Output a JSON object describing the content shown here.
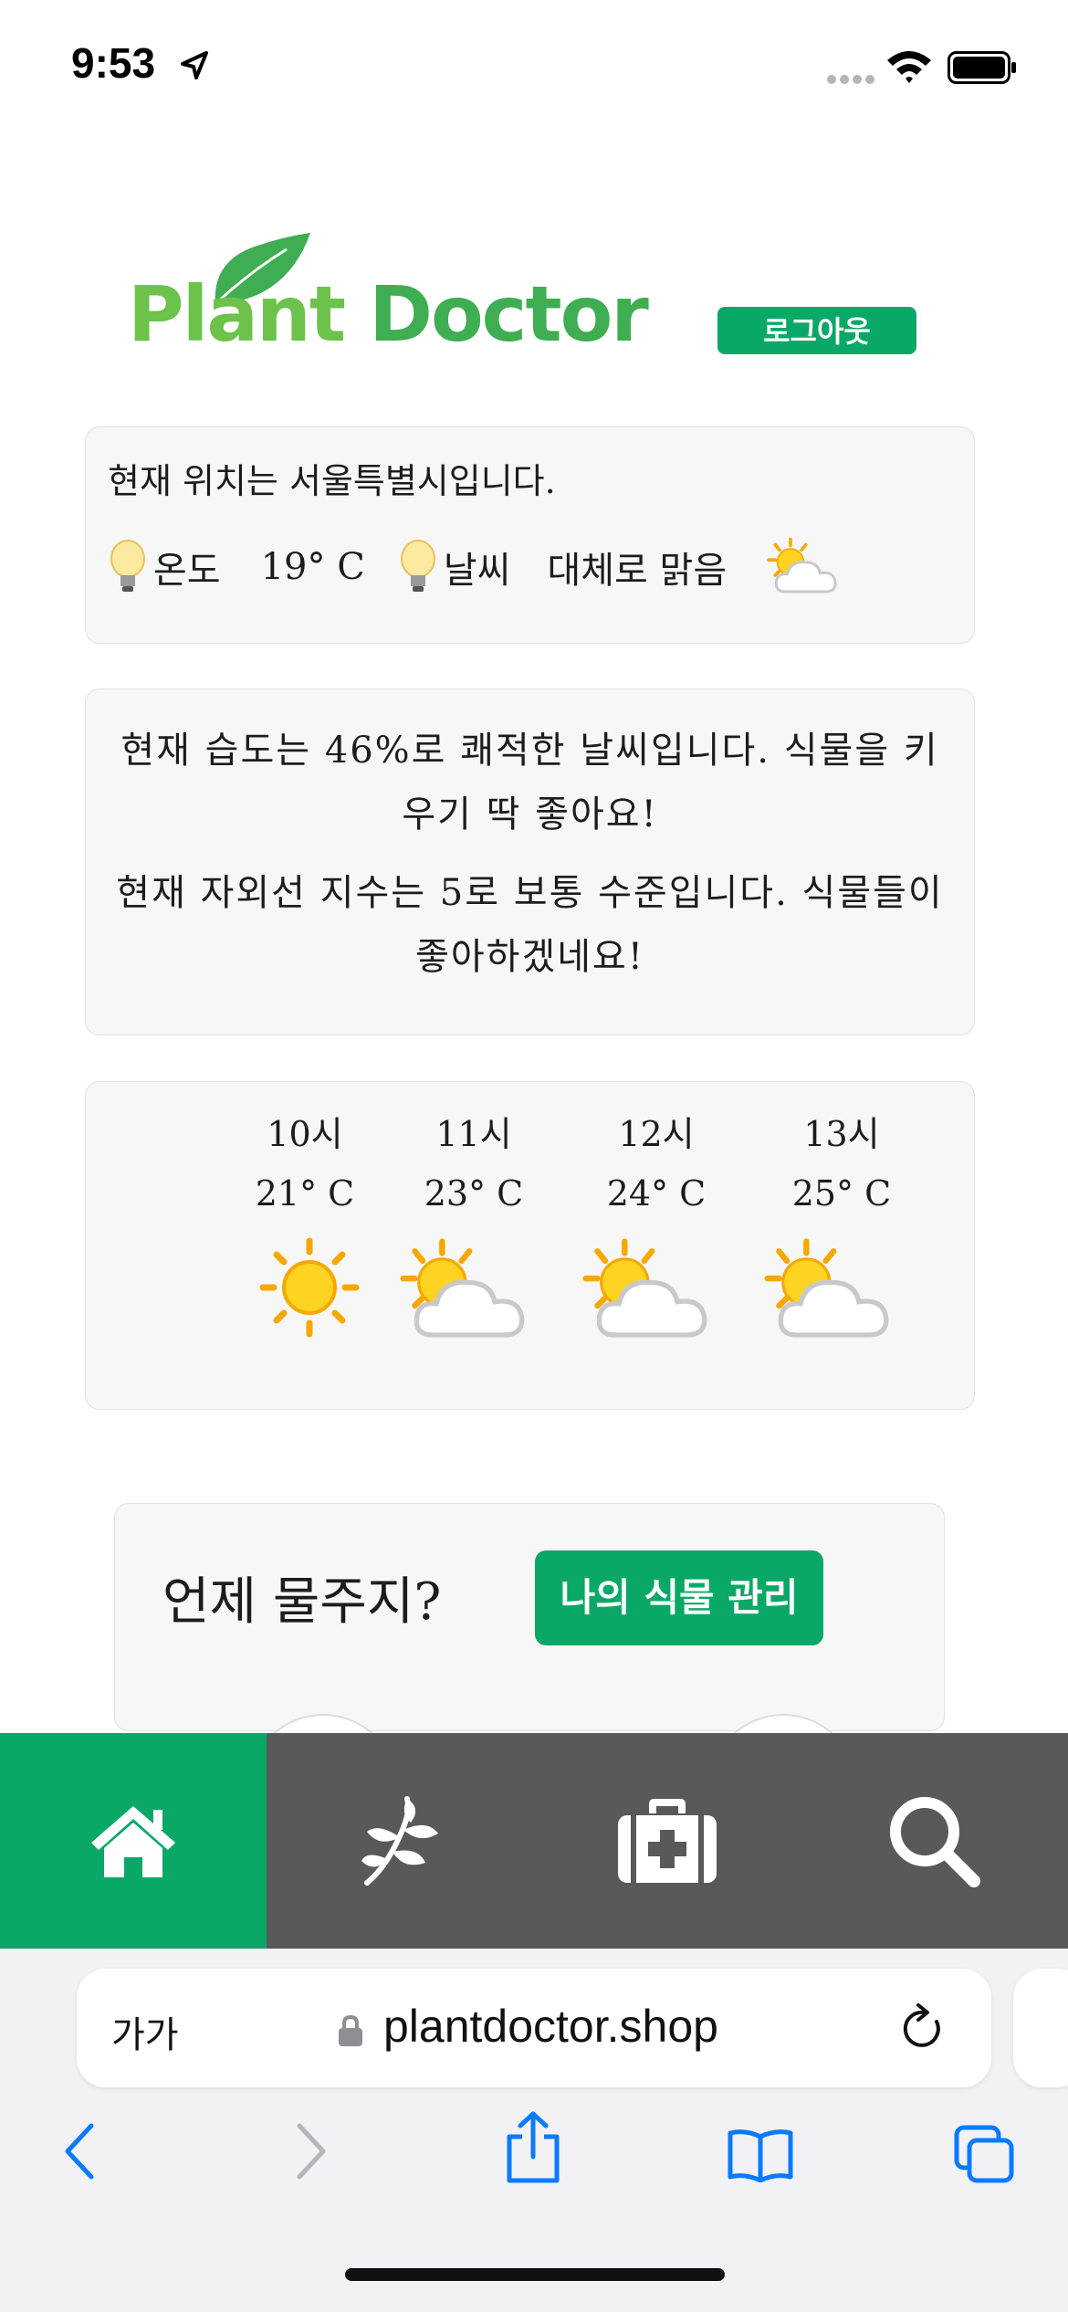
{
  "status_bar": {
    "time": "9:53"
  },
  "header": {
    "logo_word1": "Plant",
    "logo_word2": "Doctor",
    "logout_label": "로그아웃"
  },
  "location_card": {
    "location_text": "현재 위치는 서울특별시입니다.",
    "temp_label": "온도",
    "temp_value": "19° C",
    "weather_label": "날씨",
    "weather_value": "대체로 맑음",
    "weather_icon": "sun-behind-cloud-icon"
  },
  "info_card": {
    "humidity_text": "현재 습도는 46%로 쾌적한 날씨입니다. 식물을 키우기 딱 좋아요!",
    "uv_text": "현재 자외선 지수는 5로 보통 수준입니다. 식물들이 좋아하겠네요!"
  },
  "hourly": [
    {
      "hour": "10시",
      "temp": "21° C",
      "icon": "sun-icon"
    },
    {
      "hour": "11시",
      "temp": "23° C",
      "icon": "sun-behind-cloud-icon"
    },
    {
      "hour": "12시",
      "temp": "24° C",
      "icon": "sun-behind-cloud-icon"
    },
    {
      "hour": "13시",
      "temp": "25° C",
      "icon": "sun-behind-cloud-icon"
    }
  ],
  "watering_card": {
    "title": "언제 물주지?",
    "my_plants_button": "나의 식물 관리"
  },
  "bottom_nav": {
    "items": [
      {
        "icon": "home-icon",
        "active": true
      },
      {
        "icon": "plant-icon",
        "active": false
      },
      {
        "icon": "medical-kit-icon",
        "active": false
      },
      {
        "icon": "search-icon",
        "active": false
      }
    ],
    "active_color": "#0aa867",
    "inactive_color": "#595959"
  },
  "browser": {
    "text_size_label": "가가",
    "url": "plantdoctor.shop"
  }
}
